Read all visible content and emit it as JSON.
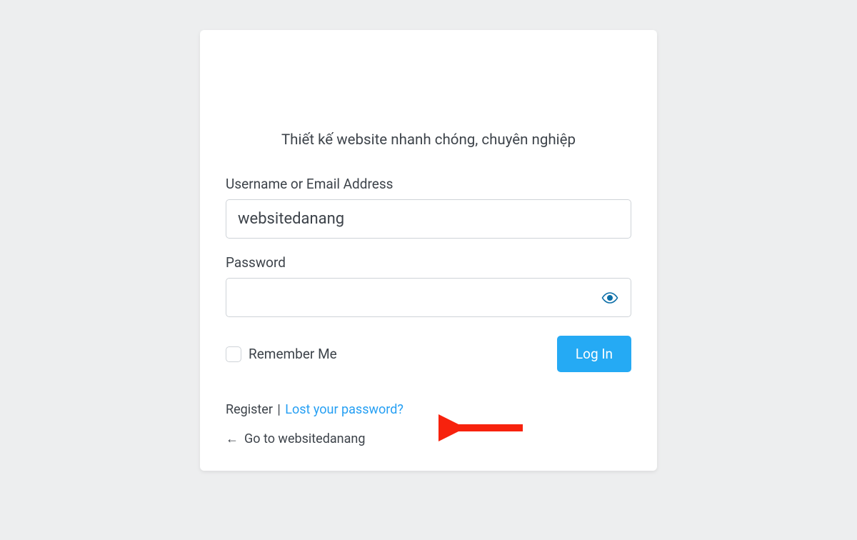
{
  "tagline": "Thiết kế website nhanh chóng, chuyên nghiệp",
  "form": {
    "username_label": "Username or Email Address",
    "username_value": "websitedanang",
    "password_label": "Password",
    "password_value": "",
    "remember_label": "Remember Me",
    "login_button": "Log In"
  },
  "nav": {
    "register": "Register",
    "separator": "|",
    "lost_password": "Lost your password?",
    "back_label": "Go to websitedanang",
    "back_arrow": "←"
  },
  "colors": {
    "accent": "#25aaf4",
    "link": "#259ff3",
    "text": "#3d434a",
    "border": "#cfd3d8",
    "bg": "#edeeef",
    "annotation": "#f7220d"
  }
}
